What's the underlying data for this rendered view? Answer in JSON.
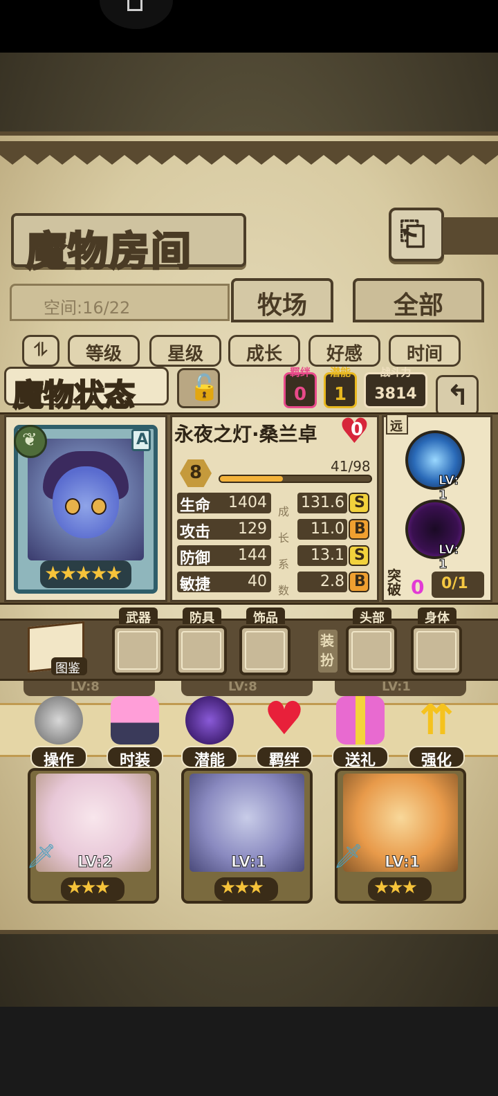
{
  "header": {
    "title": "魔物房间",
    "space": "空间:16/22"
  },
  "tabs": [
    {
      "label": "牧场"
    },
    {
      "label": "全部"
    }
  ],
  "sort": {
    "buttons": [
      "等级",
      "星级",
      "成长",
      "好感",
      "时间"
    ]
  },
  "status": {
    "title": "魔物状态",
    "bond_label": "羁绊",
    "bond_value": "0",
    "potential_label": "潜能",
    "potential_value": "1",
    "power_label": "战斗力",
    "power_value": "3814"
  },
  "monster": {
    "name": "永夜之灯·桑兰卓",
    "affection": "0",
    "rank": "A",
    "level": "8",
    "xp": "41/98",
    "xp_fraction": 0.418,
    "stars": "★★★★★",
    "stats": [
      {
        "name": "生命",
        "value": "1404",
        "growth": "131.6",
        "grade": "S"
      },
      {
        "name": "攻击",
        "value": "129",
        "growth": "11.0",
        "grade": "B"
      },
      {
        "name": "防御",
        "value": "144",
        "growth": "13.1",
        "grade": "S"
      },
      {
        "name": "敏捷",
        "value": "40",
        "growth": "2.8",
        "grade": "B"
      }
    ],
    "growth_label": [
      "成",
      "长",
      "系",
      "数"
    ],
    "range": "远",
    "skills": [
      {
        "lv": "LV: 1"
      },
      {
        "lv": "LV: 1"
      }
    ],
    "break_label": "突破",
    "break_count": "0",
    "break_progress": "0/1"
  },
  "equipment": {
    "book_label": "图鉴",
    "slots": [
      "武器",
      "防具",
      "饰品",
      "头部",
      "身体"
    ],
    "dress_label": "装扮"
  },
  "actions": [
    "操作",
    "时装",
    "潜能",
    "羁绊",
    "送礼",
    "强化"
  ],
  "cards": [
    {
      "lv": "LV:2",
      "stars": "★★★"
    },
    {
      "lv": "LV:1",
      "stars": "★★★"
    },
    {
      "lv": "LV:1",
      "stars": "★★★"
    }
  ],
  "hidden_cards": [
    "LV:8",
    "LV:8",
    "LV:1"
  ],
  "colors": {
    "grade_S": "#f2d23c",
    "grade_B": "#f0a030",
    "bond": "#e84a8a",
    "potential": "#e8b820",
    "power": "#f0e0c0"
  }
}
